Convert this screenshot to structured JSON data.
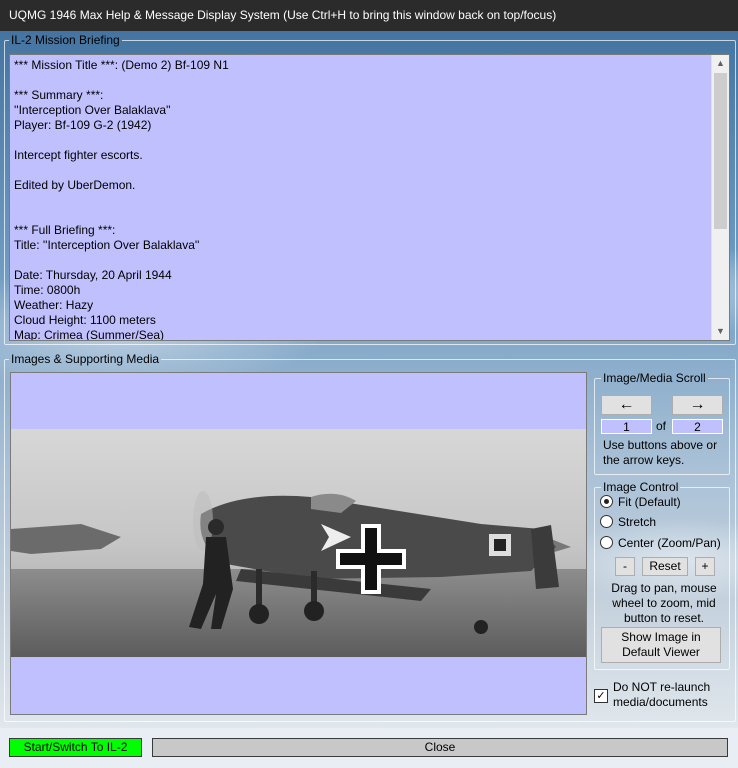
{
  "window": {
    "title": "UQMG 1946 Max Help & Message Display System (Use Ctrl+H to bring this window back on top/focus)"
  },
  "briefing": {
    "legend": "IL-2 Mission Briefing",
    "text": "*** Mission Title ***: (Demo 2) Bf-109 N1\n\n*** Summary ***:\n''Interception Over Balaklava''\nPlayer: Bf-109 G-2 (1942)\n\nIntercept fighter escorts.\n\nEdited by UberDemon.\n\n\n*** Full Briefing ***:\nTitle: ''Interception Over Balaklava''\n\nDate: Thursday, 20 April 1944\nTime: 0800h\nWeather: Hazy\nCloud Height: 1100 meters\nMap: Crimea (Summer/Sea)"
  },
  "media": {
    "legend": "Images & Supporting Media",
    "image_description": "Black-and-white photo of a Bf-109 fighter on an airfield with a crewman walking beside it"
  },
  "scroll": {
    "legend": "Image/Media Scroll",
    "prev_label": "←",
    "next_label": "→",
    "current": "1",
    "of_label": "of",
    "total": "2",
    "hint": "Use buttons above or the arrow keys."
  },
  "image_control": {
    "legend": "Image Control",
    "options": [
      "Fit (Default)",
      "Stretch",
      "Center (Zoom/Pan)"
    ],
    "selected": "Fit (Default)",
    "minus_label": "-",
    "reset_label": "Reset",
    "plus_label": "+",
    "hint": "Drag to pan, mouse wheel to zoom, mid button to reset.",
    "show_default_viewer_label": "Show Image in Default Viewer"
  },
  "relaunch": {
    "label": "Do NOT re-launch media/documents",
    "checked": true
  },
  "footer": {
    "start_label": "Start/Switch To IL-2",
    "close_label": "Close"
  },
  "colors": {
    "panel_fill": "#c0c0ff",
    "start_button": "#00ff00",
    "title_bar": "#2b2b2b"
  }
}
